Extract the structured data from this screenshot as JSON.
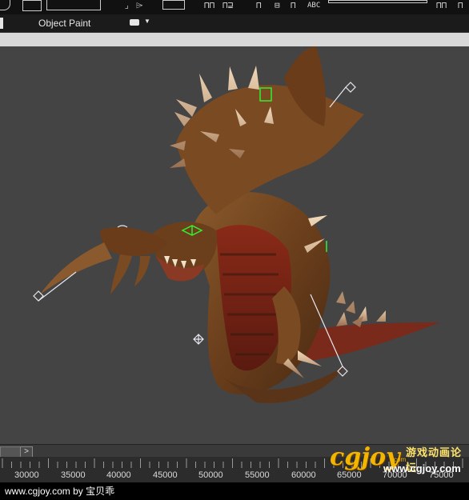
{
  "ribbon": {
    "label": "Object Paint"
  },
  "timeline": {
    "next_label": ">",
    "ticks": [
      "30000",
      "35000",
      "40000",
      "45000",
      "50000",
      "55000",
      "60000",
      "65000",
      "70000",
      "75000"
    ]
  },
  "logo": {
    "brand": "cgjoy",
    "com": "com",
    "chinese": "游戏动画论坛",
    "url": "www.cgjoy.com"
  },
  "footer": {
    "text": "www.cgjoy.com by 宝贝乖"
  },
  "colors": {
    "viewport_bg": "#444444",
    "creature_body": "#7a4a22",
    "creature_belly": "#7a2118",
    "bone_helper": "#e8e8f0",
    "selection_green": "#33ee33",
    "logo_gold": "#f2b600"
  }
}
